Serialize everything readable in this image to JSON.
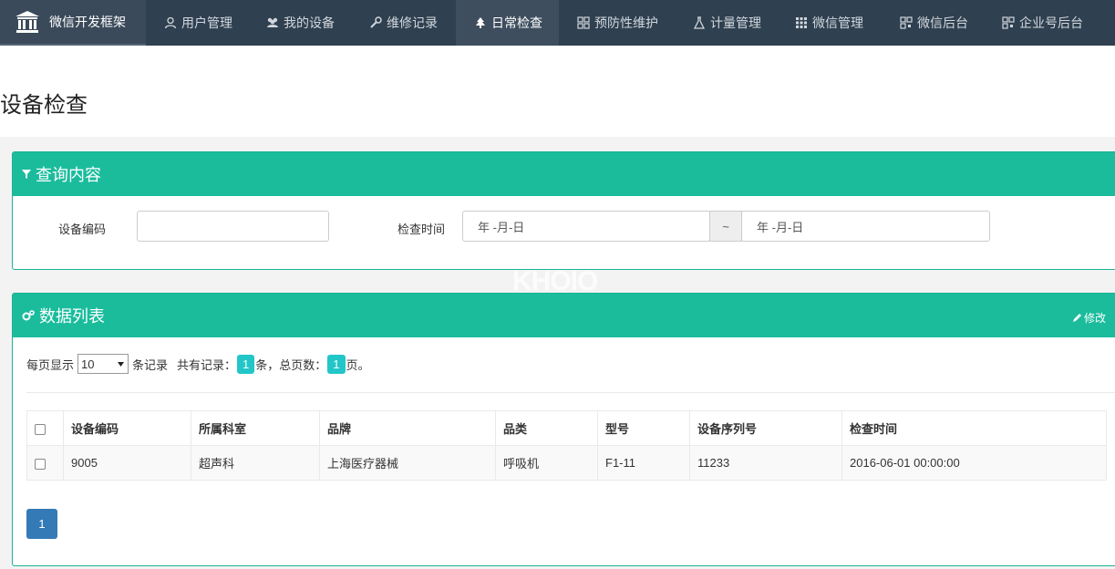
{
  "nav": {
    "brand": "微信开发框架",
    "items": [
      {
        "label": "用户管理",
        "icon": "user-icon"
      },
      {
        "label": "我的设备",
        "icon": "users-icon"
      },
      {
        "label": "维修记录",
        "icon": "wrench-icon"
      },
      {
        "label": "日常检查",
        "icon": "tree-icon"
      },
      {
        "label": "预防性维护",
        "icon": "grid-icon"
      },
      {
        "label": "计量管理",
        "icon": "flask-icon"
      },
      {
        "label": "微信管理",
        "icon": "apps-icon"
      },
      {
        "label": "微信后台",
        "icon": "qrcode-icon"
      },
      {
        "label": "企业号后台",
        "icon": "qrcode-icon"
      }
    ]
  },
  "page": {
    "title": "设备检查"
  },
  "query": {
    "title": "查询内容",
    "device_code_label": "设备编码",
    "device_code_value": "",
    "check_time_label": "检查时间",
    "date_start": "年 -月-日",
    "separator": "~",
    "date_end": "年 -月-日"
  },
  "list": {
    "title": "数据列表",
    "edit_label": "修改",
    "per_page_prefix": "每页显示",
    "per_page_value": "10",
    "per_page_suffix": "条记录",
    "total_prefix": "共有记录：",
    "total_count": "1",
    "total_mid": "条，总页数：",
    "page_count": "1",
    "total_suffix": "页。",
    "columns": [
      "设备编码",
      "所属科室",
      "品牌",
      "品类",
      "型号",
      "设备序列号",
      "检查时间"
    ],
    "rows": [
      [
        "9005",
        "超声科",
        "上海医疗器械",
        "呼吸机",
        "F1-11",
        "11233",
        "2016-06-01 00:00:00"
      ]
    ],
    "current_page": "1"
  },
  "watermark": "KHOIO"
}
